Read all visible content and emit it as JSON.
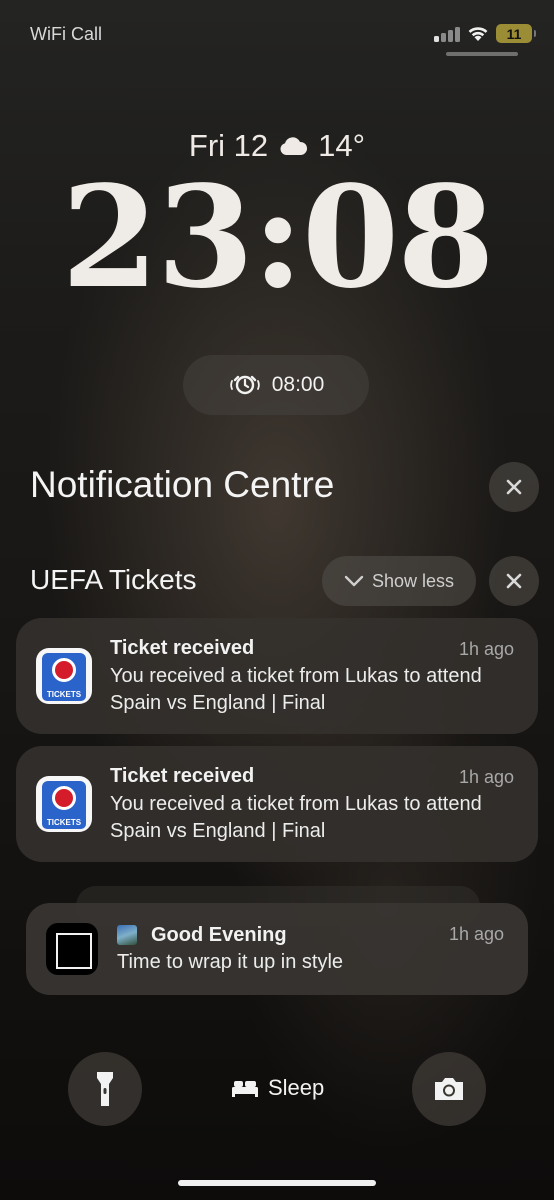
{
  "status_bar": {
    "carrier": "WiFi Call",
    "battery_level": "11",
    "signal_bars_active": 1,
    "signal_bars_total": 4,
    "battery_color": "#9b8d35"
  },
  "lock": {
    "date": "Fri 12",
    "weather_icon": "cloud-icon",
    "temperature": "14°",
    "time": "23:08",
    "alarm_icon": "alarm-clock-icon",
    "alarm_time": "08:00"
  },
  "notification_centre": {
    "title": "Notification Centre",
    "group": {
      "app_name": "UEFA Tickets",
      "show_less_label": "Show less",
      "app_icon_text": "TICKETS",
      "notifications": [
        {
          "title": "Ticket received",
          "time": "1h ago",
          "body": "You received a ticket from Lukas to attend Spain vs England | Final"
        },
        {
          "title": "Ticket received",
          "time": "1h ago",
          "body": "You received a ticket from Lukas to attend Spain vs England | Final"
        }
      ]
    },
    "stacked": {
      "title": "Good Evening",
      "time": "1h ago",
      "body": "Time to wrap it up in style"
    }
  },
  "bottom": {
    "flashlight_icon": "flashlight-icon",
    "sleep_label": "Sleep",
    "camera_icon": "camera-icon"
  }
}
